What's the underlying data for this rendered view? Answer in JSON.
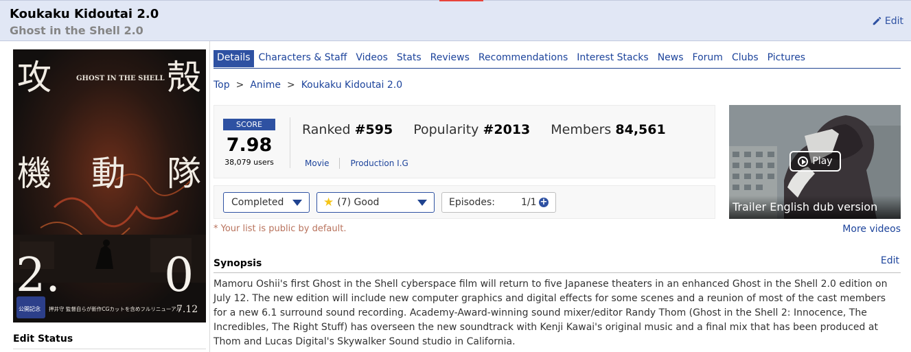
{
  "header": {
    "title": "Koukaku Kidoutai 2.0",
    "subtitle": "Ghost in the Shell 2.0",
    "edit_label": "Edit"
  },
  "left": {
    "edit_status": "Edit Status"
  },
  "tabs": [
    {
      "label": "Details",
      "active": true
    },
    {
      "label": "Characters & Staff"
    },
    {
      "label": "Videos"
    },
    {
      "label": "Stats"
    },
    {
      "label": "Reviews"
    },
    {
      "label": "Recommendations"
    },
    {
      "label": "Interest Stacks"
    },
    {
      "label": "News"
    },
    {
      "label": "Forum"
    },
    {
      "label": "Clubs"
    },
    {
      "label": "Pictures"
    }
  ],
  "breadcrumb": {
    "items": [
      "Top",
      "Anime",
      "Koukaku Kidoutai 2.0"
    ],
    "separator": ">"
  },
  "stats": {
    "score_label": "SCORE",
    "score": "7.98",
    "users": "38,079 users",
    "ranked_label": "Ranked",
    "ranked": "#595",
    "popularity_label": "Popularity",
    "popularity": "#2013",
    "members_label": "Members",
    "members": "84,561",
    "type": "Movie",
    "studio": "Production I.G"
  },
  "list": {
    "status": "Completed",
    "score_text": "(7) Good",
    "episodes_label": "Episodes:",
    "episodes_count": "1/1",
    "plus": "+",
    "public_note": "* Your list is public by default."
  },
  "trailer": {
    "play_label": "Play",
    "caption": "Trailer English dub version",
    "more_videos": "More videos"
  },
  "synopsis": {
    "heading": "Synopsis",
    "edit_label": "Edit",
    "text": "Mamoru Oshii's first Ghost in the Shell cyberspace film will return to five Japanese theaters in an enhanced Ghost in the Shell 2.0 edition on July 12. The new edition will include new computer graphics and digital effects for some scenes and a reunion of most of the cast members for a new 6.1 surround sound recording. Academy-Award-winning sound mixer/editor Randy Thom (Ghost in the Shell 2: Innocence, The Incredibles, The Right Stuff) has overseen the new soundtrack with Kenji Kawai's original music and a final mix that has been produced at Thom and Lucas Digital's Skywalker Sound studio in California."
  },
  "colors": {
    "accent": "#2e51a2",
    "link": "#1c439b",
    "header_bg": "#e1e7f5",
    "note": "#b8725c",
    "star": "#f5c518"
  },
  "icons": {
    "edit": "pencil-icon",
    "caret": "caret-down-icon",
    "star": "star-icon",
    "play": "play-icon",
    "plus": "plus-circle-icon"
  },
  "cover": {
    "kanji_top_left": "攻",
    "kanji_top_right": "殻",
    "kanji_row": [
      "機",
      "動",
      "隊"
    ],
    "logo": "GHOST IN THE SHELL",
    "big_left": "2.",
    "big_right": "0",
    "date": "7.12",
    "bottom_text": "押井守 監督自らが新作CGカットを含めフルリニューアル",
    "badge": "公開記念"
  }
}
